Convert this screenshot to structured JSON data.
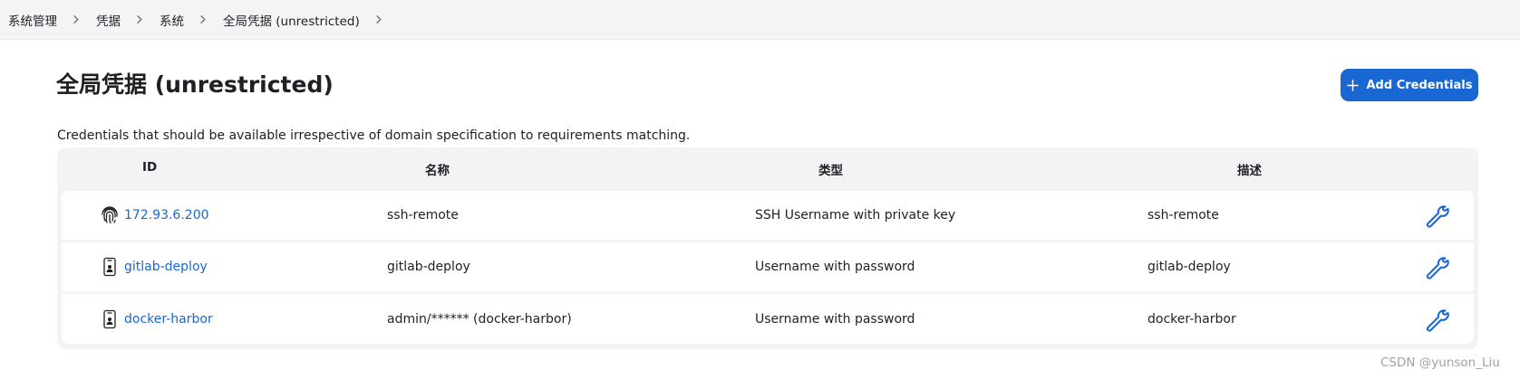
{
  "breadcrumb": {
    "items": [
      {
        "label": "系统管理"
      },
      {
        "label": "凭据"
      },
      {
        "label": "系统"
      },
      {
        "label": "全局凭据 (unrestricted)"
      }
    ]
  },
  "page": {
    "title": "全局凭据 (unrestricted)",
    "description": "Credentials that should be available irrespective of domain specification to requirements matching.",
    "add_button_label": "Add Credentials"
  },
  "table": {
    "columns": [
      "ID",
      "名称",
      "类型",
      "描述"
    ],
    "rows": [
      {
        "icon": "fingerprint-icon",
        "id": "172.93.6.200",
        "name": "ssh-remote",
        "type": "SSH Username with private key",
        "description": "ssh-remote"
      },
      {
        "icon": "id-badge-icon",
        "id": "gitlab-deploy",
        "name": "gitlab-deploy",
        "type": "Username with password",
        "description": "gitlab-deploy"
      },
      {
        "icon": "id-badge-icon",
        "id": "docker-harbor",
        "name": "admin/****** (docker-harbor)",
        "type": "Username with password",
        "description": "docker-harbor"
      }
    ]
  },
  "watermark": "CSDN @yunson_Liu",
  "colors": {
    "accent": "#1967d2",
    "table_bg": "#f3f3f6",
    "breadcrumb_bg": "#f4f4f6"
  }
}
